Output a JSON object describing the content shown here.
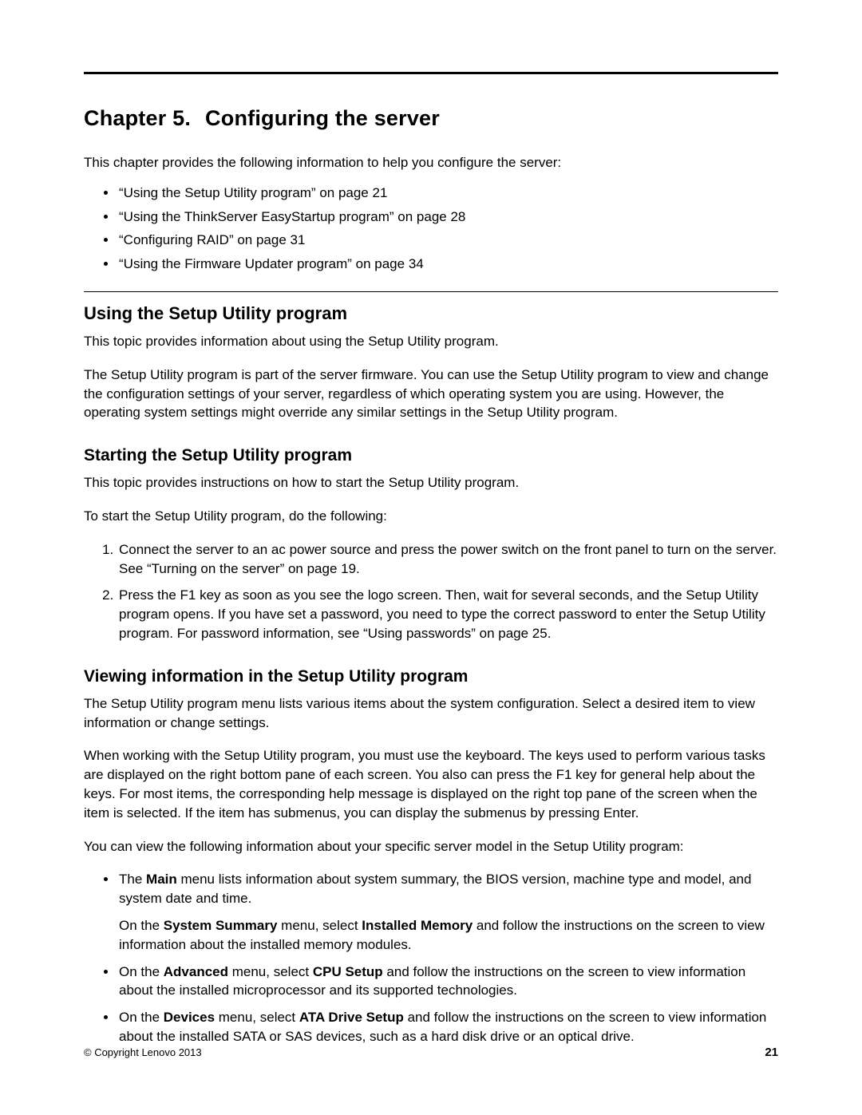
{
  "chapter": {
    "label": "Chapter 5.",
    "title": "Configuring the server"
  },
  "intro": "This chapter provides the following information to help you configure the server:",
  "refs": [
    "“Using the Setup Utility program” on page 21",
    "“Using the ThinkServer EasyStartup program” on page 28",
    "“Configuring RAID” on page 31",
    "“Using the Firmware Updater program” on page 34"
  ],
  "sec1": {
    "title": "Using the Setup Utility program",
    "p1": "This topic provides information about using the Setup Utility program.",
    "p2": "The Setup Utility program is part of the server firmware. You can use the Setup Utility program to view and change the configuration settings of your server, regardless of which operating system you are using. However, the operating system settings might override any similar settings in the Setup Utility program."
  },
  "sec2": {
    "title": "Starting the Setup Utility program",
    "p1": "This topic provides instructions on how to start the Setup Utility program.",
    "p2": "To start the Setup Utility program, do the following:",
    "steps": [
      "Connect the server to an ac power source and press the power switch on the front panel to turn on the server. See “Turning on the server” on page 19.",
      "Press the F1 key as soon as you see the logo screen. Then, wait for several seconds, and the Setup Utility program opens. If you have set a password, you need to type the correct password to enter the Setup Utility program. For password information, see “Using passwords” on page 25."
    ]
  },
  "sec3": {
    "title": "Viewing information in the Setup Utility program",
    "p1": "The Setup Utility program menu lists various items about the system configuration. Select a desired item to view information or change settings.",
    "p2": "When working with the Setup Utility program, you must use the keyboard. The keys used to perform various tasks are displayed on the right bottom pane of each screen. You also can press the F1 key for general help about the keys. For most items, the corresponding help message is displayed on the right top pane of the screen when the item is selected. If the item has submenus, you can display the submenus by pressing Enter.",
    "p3": "You can view the following information about your specific server model in the Setup Utility program:",
    "items": [
      {
        "pre1": "The ",
        "b1": "Main",
        "post1": " menu lists information about system summary, the BIOS version, machine type and model, and system date and time.",
        "sub_pre": "On the ",
        "sub_b1": "System Summary",
        "sub_mid": " menu, select ",
        "sub_b2": "Installed Memory",
        "sub_post": " and follow the instructions on the screen to view information about the installed memory modules."
      },
      {
        "pre1": "On the ",
        "b1": "Advanced",
        "mid1": " menu, select ",
        "b2": "CPU Setup",
        "post1": " and follow the instructions on the screen to view information about the installed microprocessor and its supported technologies."
      },
      {
        "pre1": "On the ",
        "b1": "Devices",
        "mid1": " menu, select ",
        "b2": "ATA Drive Setup",
        "post1": " and follow the instructions on the screen to view information about the installed SATA or SAS devices, such as a hard disk drive or an optical drive."
      }
    ]
  },
  "footer": {
    "copyright": "© Copyright Lenovo 2013",
    "page": "21"
  }
}
